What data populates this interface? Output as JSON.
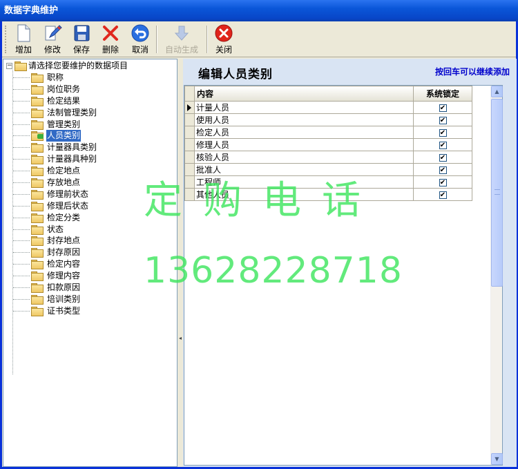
{
  "window": {
    "title": "数据字典维护"
  },
  "toolbar": {
    "add_label": "增加",
    "edit_label": "修改",
    "save_label": "保存",
    "delete_label": "删除",
    "cancel_label": "取消",
    "autogen_label": "自动生成",
    "close_label": "关闭"
  },
  "tree": {
    "root_label": "请选择您要维护的数据项目",
    "items": [
      "职称",
      "岗位职务",
      "检定结果",
      "法制管理类别",
      "管理类别",
      "人员类别",
      "计量器具类别",
      "计量器具种别",
      "检定地点",
      "存放地点",
      "修理前状态",
      "修理后状态",
      "检定分类",
      "状态",
      "封存地点",
      "封存原因",
      "检定内容",
      "修理内容",
      "扣款原因",
      "培训类别",
      "证书类型"
    ],
    "selected_index": 5
  },
  "panel": {
    "title": "编辑人员类别",
    "hint": "按回车可以继续添加"
  },
  "grid": {
    "col_content": "内容",
    "col_locked": "系统锁定",
    "rows": [
      {
        "content": "计量人员",
        "locked": true
      },
      {
        "content": "使用人员",
        "locked": true
      },
      {
        "content": "检定人员",
        "locked": true
      },
      {
        "content": "修理人员",
        "locked": true
      },
      {
        "content": "核验人员",
        "locked": true
      },
      {
        "content": "批准人",
        "locked": true
      },
      {
        "content": "工程师",
        "locked": true
      },
      {
        "content": "其他人员",
        "locked": true
      }
    ]
  },
  "watermark": {
    "line1": "定购电话",
    "line2": "13628228718"
  }
}
